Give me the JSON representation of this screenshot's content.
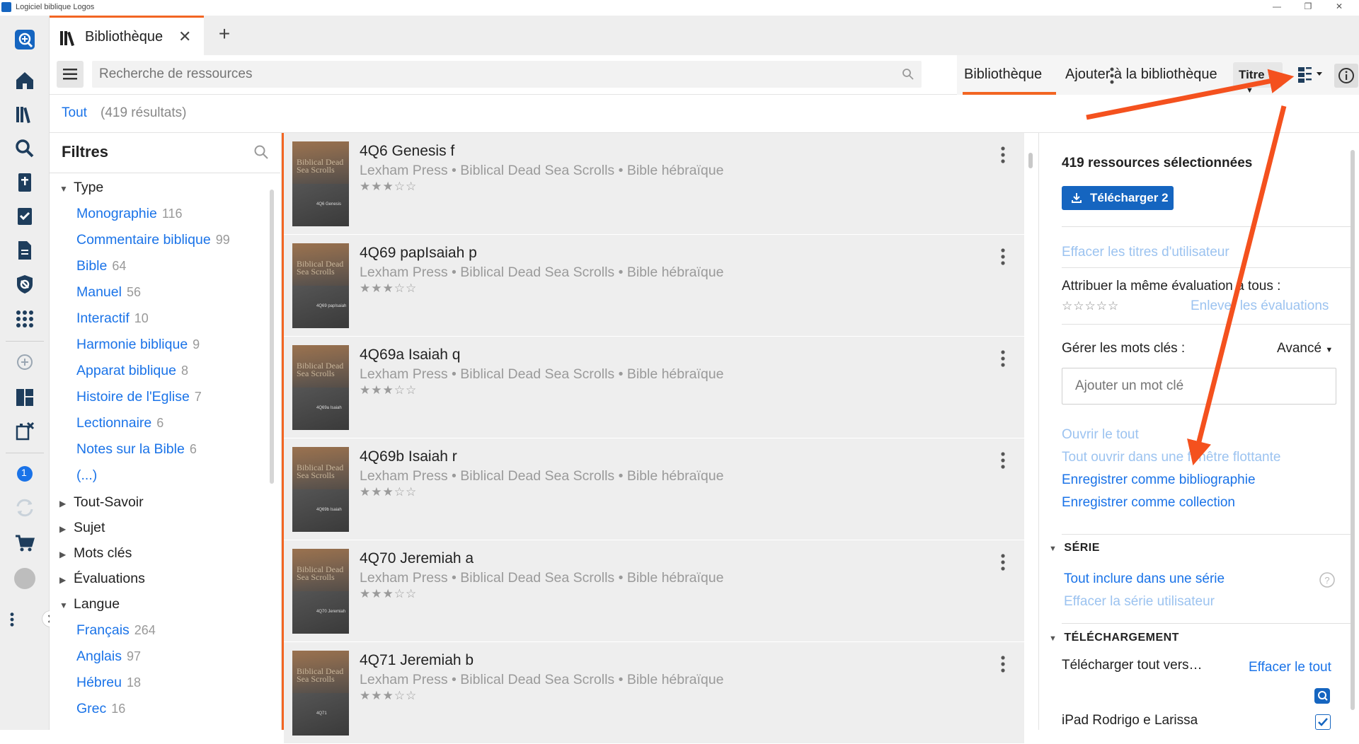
{
  "window": {
    "title": "Logiciel biblique Logos"
  },
  "tabs": [
    {
      "label": "Bibliothèque"
    }
  ],
  "toolbar": {
    "search_placeholder": "Recherche de ressources",
    "tab_library": "Bibliothèque",
    "tab_add": "Ajouter à la bibliothèque",
    "sort_label": "Titre"
  },
  "scope": {
    "label": "Tout",
    "count": "(419 résultats)"
  },
  "filters": {
    "heading": "Filtres",
    "type_label": "Type",
    "type_items": [
      {
        "label": "Monographie",
        "count": "116"
      },
      {
        "label": "Commentaire biblique",
        "count": "99"
      },
      {
        "label": "Bible",
        "count": "64"
      },
      {
        "label": "Manuel",
        "count": "56"
      },
      {
        "label": "Interactif",
        "count": "10"
      },
      {
        "label": "Harmonie biblique",
        "count": "9"
      },
      {
        "label": "Apparat biblique",
        "count": "8"
      },
      {
        "label": "Histoire de l'Eglise",
        "count": "7"
      },
      {
        "label": "Lectionnaire",
        "count": "6"
      },
      {
        "label": "Notes sur la Bible",
        "count": "6"
      }
    ],
    "more_label": "(...)",
    "collapsed_groups": [
      "Tout-Savoir",
      "Sujet",
      "Mots clés",
      "Évaluations"
    ],
    "language_label": "Langue",
    "language_items": [
      {
        "label": "Français",
        "count": "264"
      },
      {
        "label": "Anglais",
        "count": "97"
      },
      {
        "label": "Hébreu",
        "count": "18"
      },
      {
        "label": "Grec",
        "count": "16"
      }
    ]
  },
  "results": [
    {
      "title": "4Q6 Genesis f",
      "subtitle": "Lexham Press • Biblical Dead Sea Scrolls • Bible hébraïque",
      "stars": "★★★☆☆",
      "cover_text": "Biblical Dead Sea Scrolls",
      "cover_small": "4Q6 Genesis"
    },
    {
      "title": "4Q69 papIsaiah p",
      "subtitle": "Lexham Press • Biblical Dead Sea Scrolls • Bible hébraïque",
      "stars": "★★★☆☆",
      "cover_text": "Biblical Dead Sea Scrolls",
      "cover_small": "4Q69 papIsaiah"
    },
    {
      "title": "4Q69a Isaiah q",
      "subtitle": "Lexham Press • Biblical Dead Sea Scrolls • Bible hébraïque",
      "stars": "★★★☆☆",
      "cover_text": "Biblical Dead Sea Scrolls",
      "cover_small": "4Q69a Isaiah"
    },
    {
      "title": "4Q69b Isaiah r",
      "subtitle": "Lexham Press • Biblical Dead Sea Scrolls • Bible hébraïque",
      "stars": "★★★☆☆",
      "cover_text": "Biblical Dead Sea Scrolls",
      "cover_small": "4Q69b Isaiah"
    },
    {
      "title": "4Q70 Jeremiah a",
      "subtitle": "Lexham Press • Biblical Dead Sea Scrolls • Bible hébraïque",
      "stars": "★★★☆☆",
      "cover_text": "Biblical Dead Sea Scrolls",
      "cover_small": "4Q70 Jeremiah"
    },
    {
      "title": "4Q71 Jeremiah b",
      "subtitle": "Lexham Press • Biblical Dead Sea Scrolls • Bible hébraïque",
      "stars": "★★★☆☆",
      "cover_text": "Biblical Dead Sea Scrolls",
      "cover_small": "4Q71"
    }
  ],
  "info": {
    "selected": "419 ressources sélectionnées",
    "download_button": "Télécharger 2",
    "clear_titles": "Effacer les titres d'utilisateur",
    "rating_label": "Attribuer la même évaluation à tous :",
    "rating_stars": "☆☆☆☆☆",
    "clear_ratings": "Enlever les évaluations",
    "keywords_label": "Gérer les mots clés :",
    "advanced": "Avancé",
    "keyword_placeholder": "Ajouter un mot clé",
    "open_all": "Ouvrir le tout",
    "open_floating": "Tout ouvrir dans une fenêtre flottante",
    "save_bibliography": "Enregistrer comme bibliographie",
    "save_collection": "Enregistrer comme collection",
    "series_heading": "SÉRIE",
    "series_include": "Tout inclure dans une série",
    "series_clear": "Effacer la série utilisateur",
    "download_heading": "TÉLÉCHARGEMENT",
    "download_all_to": "Télécharger tout vers…",
    "clear_all": "Effacer le tout",
    "device": "iPad Rodrigo e Larissa"
  },
  "rail": {
    "badge": "1"
  },
  "colors": {
    "accent": "#f26522",
    "link": "#1a73e8",
    "primary_button": "#1565c0"
  }
}
